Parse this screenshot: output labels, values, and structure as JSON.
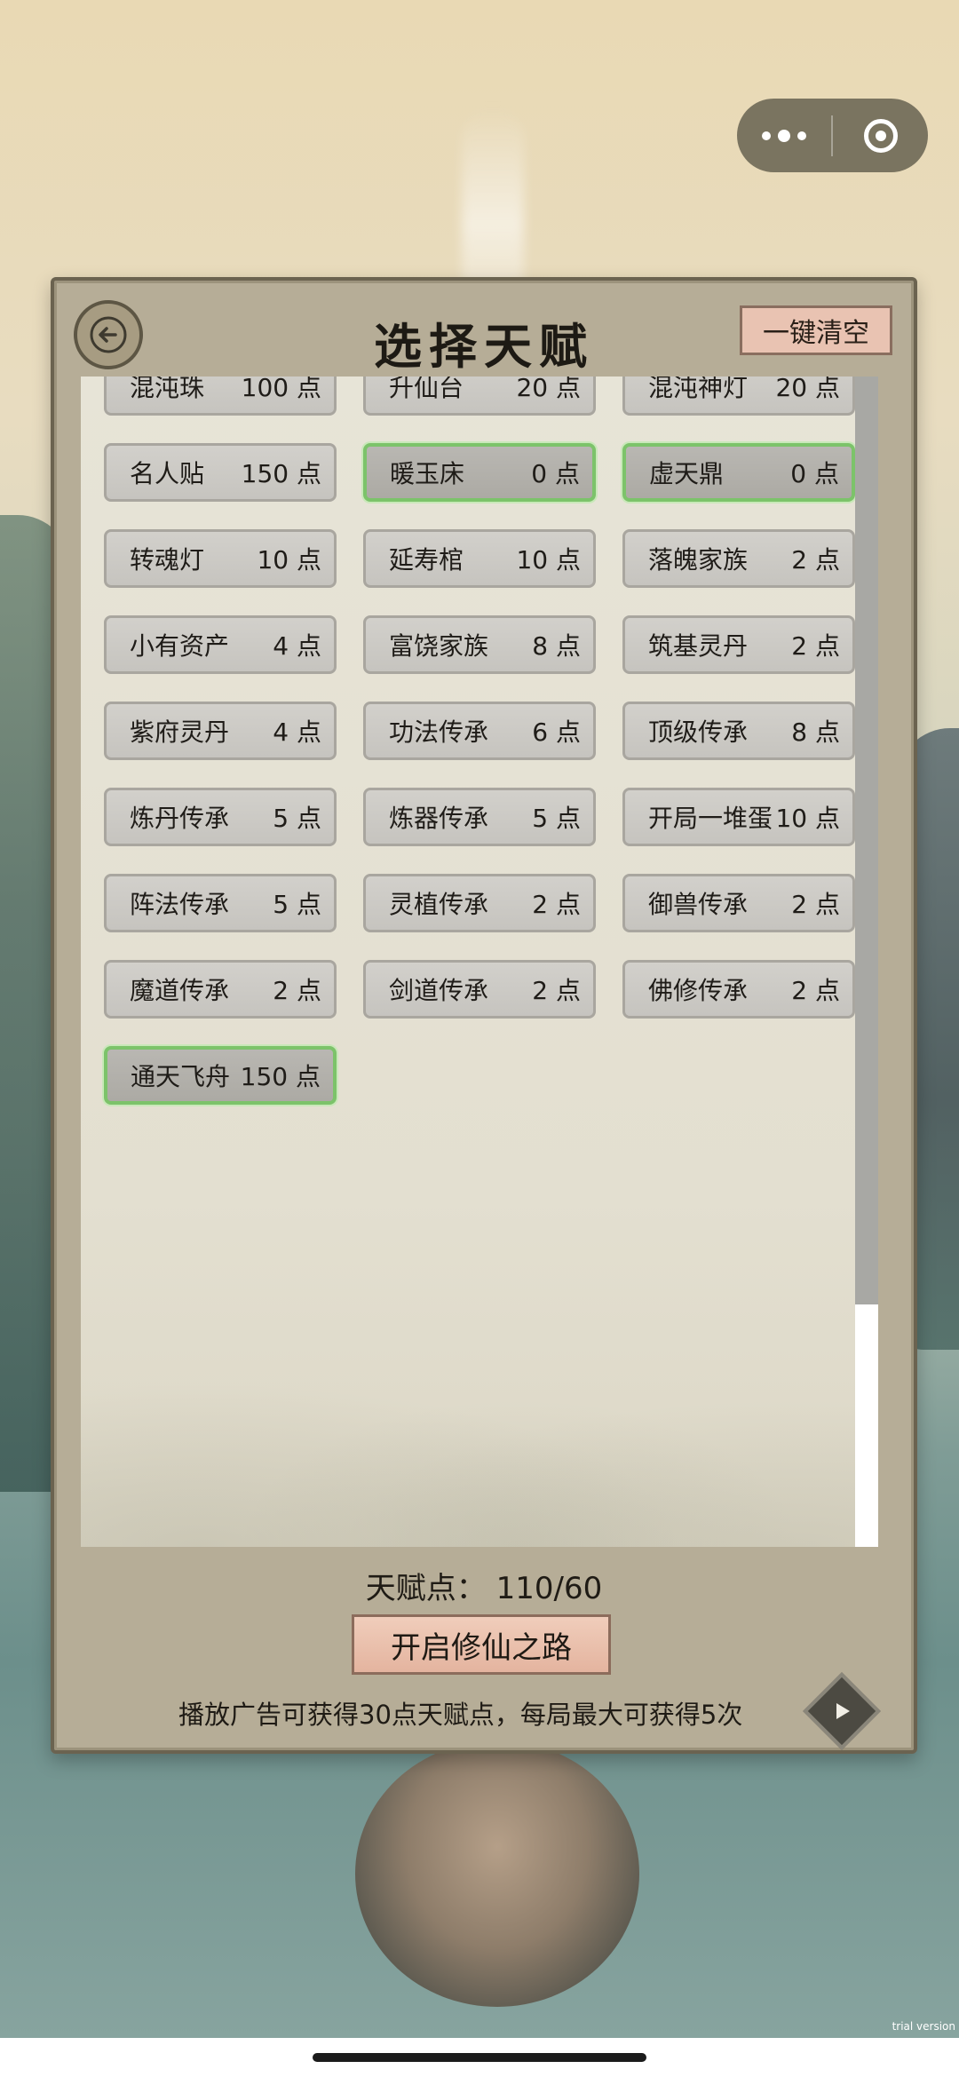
{
  "capsule": {
    "more_icon": "more-dots-icon",
    "close_icon": "target-close-icon"
  },
  "panel": {
    "title": "选择天赋",
    "clear_label": "一键清空",
    "back_icon": "back-arrow-icon"
  },
  "talents": [
    {
      "name": "混沌珠",
      "cost": "100 点",
      "selected": false
    },
    {
      "name": "升仙台",
      "cost": "20 点",
      "selected": false
    },
    {
      "name": "混沌神灯",
      "cost": "20 点",
      "selected": false
    },
    {
      "name": "名人贴",
      "cost": "150 点",
      "selected": false
    },
    {
      "name": "暖玉床",
      "cost": "0 点",
      "selected": true
    },
    {
      "name": "虚天鼎",
      "cost": "0 点",
      "selected": true
    },
    {
      "name": "转魂灯",
      "cost": "10 点",
      "selected": false
    },
    {
      "name": "延寿棺",
      "cost": "10 点",
      "selected": false
    },
    {
      "name": "落魄家族",
      "cost": "2 点",
      "selected": false
    },
    {
      "name": "小有资产",
      "cost": "4 点",
      "selected": false
    },
    {
      "name": "富饶家族",
      "cost": "8 点",
      "selected": false
    },
    {
      "name": "筑基灵丹",
      "cost": "2 点",
      "selected": false
    },
    {
      "name": "紫府灵丹",
      "cost": "4 点",
      "selected": false
    },
    {
      "name": "功法传承",
      "cost": "6 点",
      "selected": false
    },
    {
      "name": "顶级传承",
      "cost": "8 点",
      "selected": false
    },
    {
      "name": "炼丹传承",
      "cost": "5 点",
      "selected": false
    },
    {
      "name": "炼器传承",
      "cost": "5 点",
      "selected": false
    },
    {
      "name": "开局一堆蛋",
      "cost": "10 点",
      "selected": false
    },
    {
      "name": "阵法传承",
      "cost": "5 点",
      "selected": false
    },
    {
      "name": "灵植传承",
      "cost": "2 点",
      "selected": false
    },
    {
      "name": "御兽传承",
      "cost": "2 点",
      "selected": false
    },
    {
      "name": "魔道传承",
      "cost": "2 点",
      "selected": false
    },
    {
      "name": "剑道传承",
      "cost": "2 点",
      "selected": false
    },
    {
      "name": "佛修传承",
      "cost": "2 点",
      "selected": false
    },
    {
      "name": "通天飞舟",
      "cost": "150 点",
      "selected": true
    }
  ],
  "footer": {
    "points_text": "天赋点：  110/60",
    "start_label": "开启修仙之路",
    "ad_note": "播放广告可获得30点天赋点，每局最大可获得5次",
    "play_icon": "play-ad-icon"
  },
  "scrollbar": {
    "position_fraction": 0.0
  },
  "watermark": "trial version",
  "colors": {
    "selected_border": "#7cc36a",
    "clear_button": "#e9c3b2",
    "start_button": "#e4b49f",
    "panel": "#b6ad97"
  }
}
